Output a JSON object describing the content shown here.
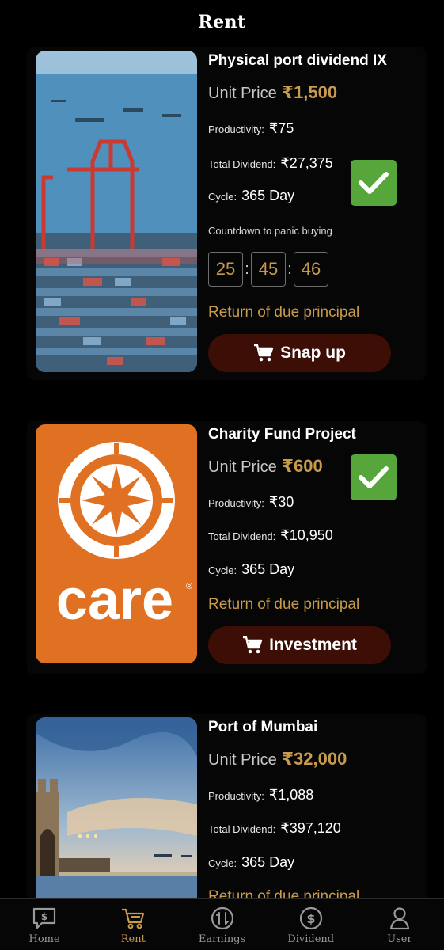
{
  "header": {
    "title": "Rent"
  },
  "products": [
    {
      "title": "Physical port dividend IX",
      "unit_price_label": "Unit Price",
      "unit_price": "₹1,500",
      "productivity_label": "Productivity:",
      "productivity": "₹75",
      "total_dividend_label": "Total Dividend:",
      "total_dividend": "₹27,375",
      "cycle_label": "Cycle:",
      "cycle": "365 Day",
      "countdown_label": "Countdown to panic buying",
      "countdown": {
        "h": "25",
        "m": "45",
        "s": "46"
      },
      "return_text": "Return of due principal",
      "button_label": "Snap up",
      "image": "port-cranes-image",
      "checked": true
    },
    {
      "title": "Charity Fund Project",
      "unit_price_label": "Unit Price",
      "unit_price": "₹600",
      "productivity_label": "Productivity:",
      "productivity": "₹30",
      "total_dividend_label": "Total Dividend:",
      "total_dividend": "₹10,950",
      "cycle_label": "Cycle:",
      "cycle": "365 Day",
      "return_text": "Return of due principal",
      "button_label": "Investment",
      "image": "care-logo-image",
      "logo_text": "care",
      "checked": true
    },
    {
      "title": "Port of Mumbai",
      "unit_price_label": "Unit Price",
      "unit_price": "₹32,000",
      "productivity_label": "Productivity:",
      "productivity": "₹1,088",
      "total_dividend_label": "Total Dividend:",
      "total_dividend": "₹397,120",
      "cycle_label": "Cycle:",
      "cycle": "365 Day",
      "return_text": "Return of due principal",
      "image": "gateway-of-india-image"
    }
  ],
  "tabbar": {
    "active": "rent",
    "tabs": [
      {
        "label": "Home",
        "icon": "chat-dollar-icon"
      },
      {
        "label": "Rent",
        "icon": "cart-icon"
      },
      {
        "label": "Earnings",
        "icon": "exchange-icon"
      },
      {
        "label": "Dividend",
        "icon": "dollar-circle-icon"
      },
      {
        "label": "User",
        "icon": "user-icon"
      }
    ]
  },
  "colors": {
    "accent": "#c89a4c",
    "button_bg": "#3c0e06",
    "check_green": "#56a63b",
    "background": "#000000"
  }
}
